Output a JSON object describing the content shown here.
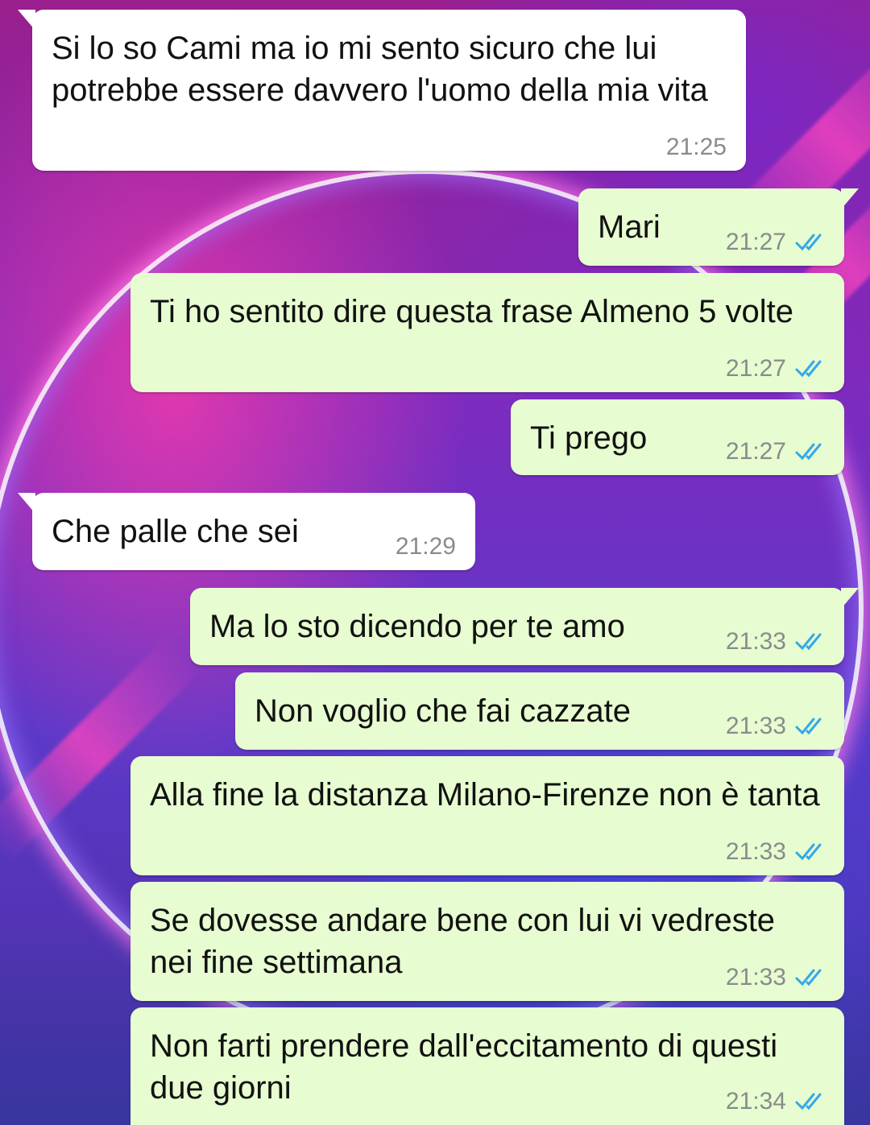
{
  "colors": {
    "incoming_bubble": "#ffffff",
    "outgoing_bubble": "#e7fcd0",
    "timestamp": "#888c8a",
    "read_ticks": "#33a9e9"
  },
  "messages": [
    {
      "direction": "incoming",
      "text": "Si lo so Cami ma io mi sento sicuro che lui potrebbe essere davvero l'uomo della mia vita",
      "time": "21:25"
    },
    {
      "direction": "outgoing",
      "text": "Mari",
      "time": "21:27",
      "status": "read-double-check-icon"
    },
    {
      "direction": "outgoing",
      "text": "Ti ho sentito dire questa frase Almeno 5 volte",
      "time": "21:27",
      "status": "read-double-check-icon"
    },
    {
      "direction": "outgoing",
      "text": "Ti prego",
      "time": "21:27",
      "status": "read-double-check-icon"
    },
    {
      "direction": "incoming",
      "text": "Che palle che sei",
      "time": "21:29"
    },
    {
      "direction": "outgoing",
      "text": "Ma lo sto dicendo per te amo",
      "time": "21:33",
      "status": "read-double-check-icon"
    },
    {
      "direction": "outgoing",
      "text": "Non voglio che fai cazzate",
      "time": "21:33",
      "status": "read-double-check-icon"
    },
    {
      "direction": "outgoing",
      "text": "Alla fine la distanza Milano-Firenze non è tanta",
      "time": "21:33",
      "status": "read-double-check-icon"
    },
    {
      "direction": "outgoing",
      "text": "Se dovesse andare bene con lui vi vedreste nei fine settimana",
      "time": "21:33",
      "status": "read-double-check-icon"
    },
    {
      "direction": "outgoing",
      "text": "Non farti prendere dall'eccitamento di questi due giorni",
      "time": "21:34",
      "status": "read-double-check-icon"
    }
  ]
}
